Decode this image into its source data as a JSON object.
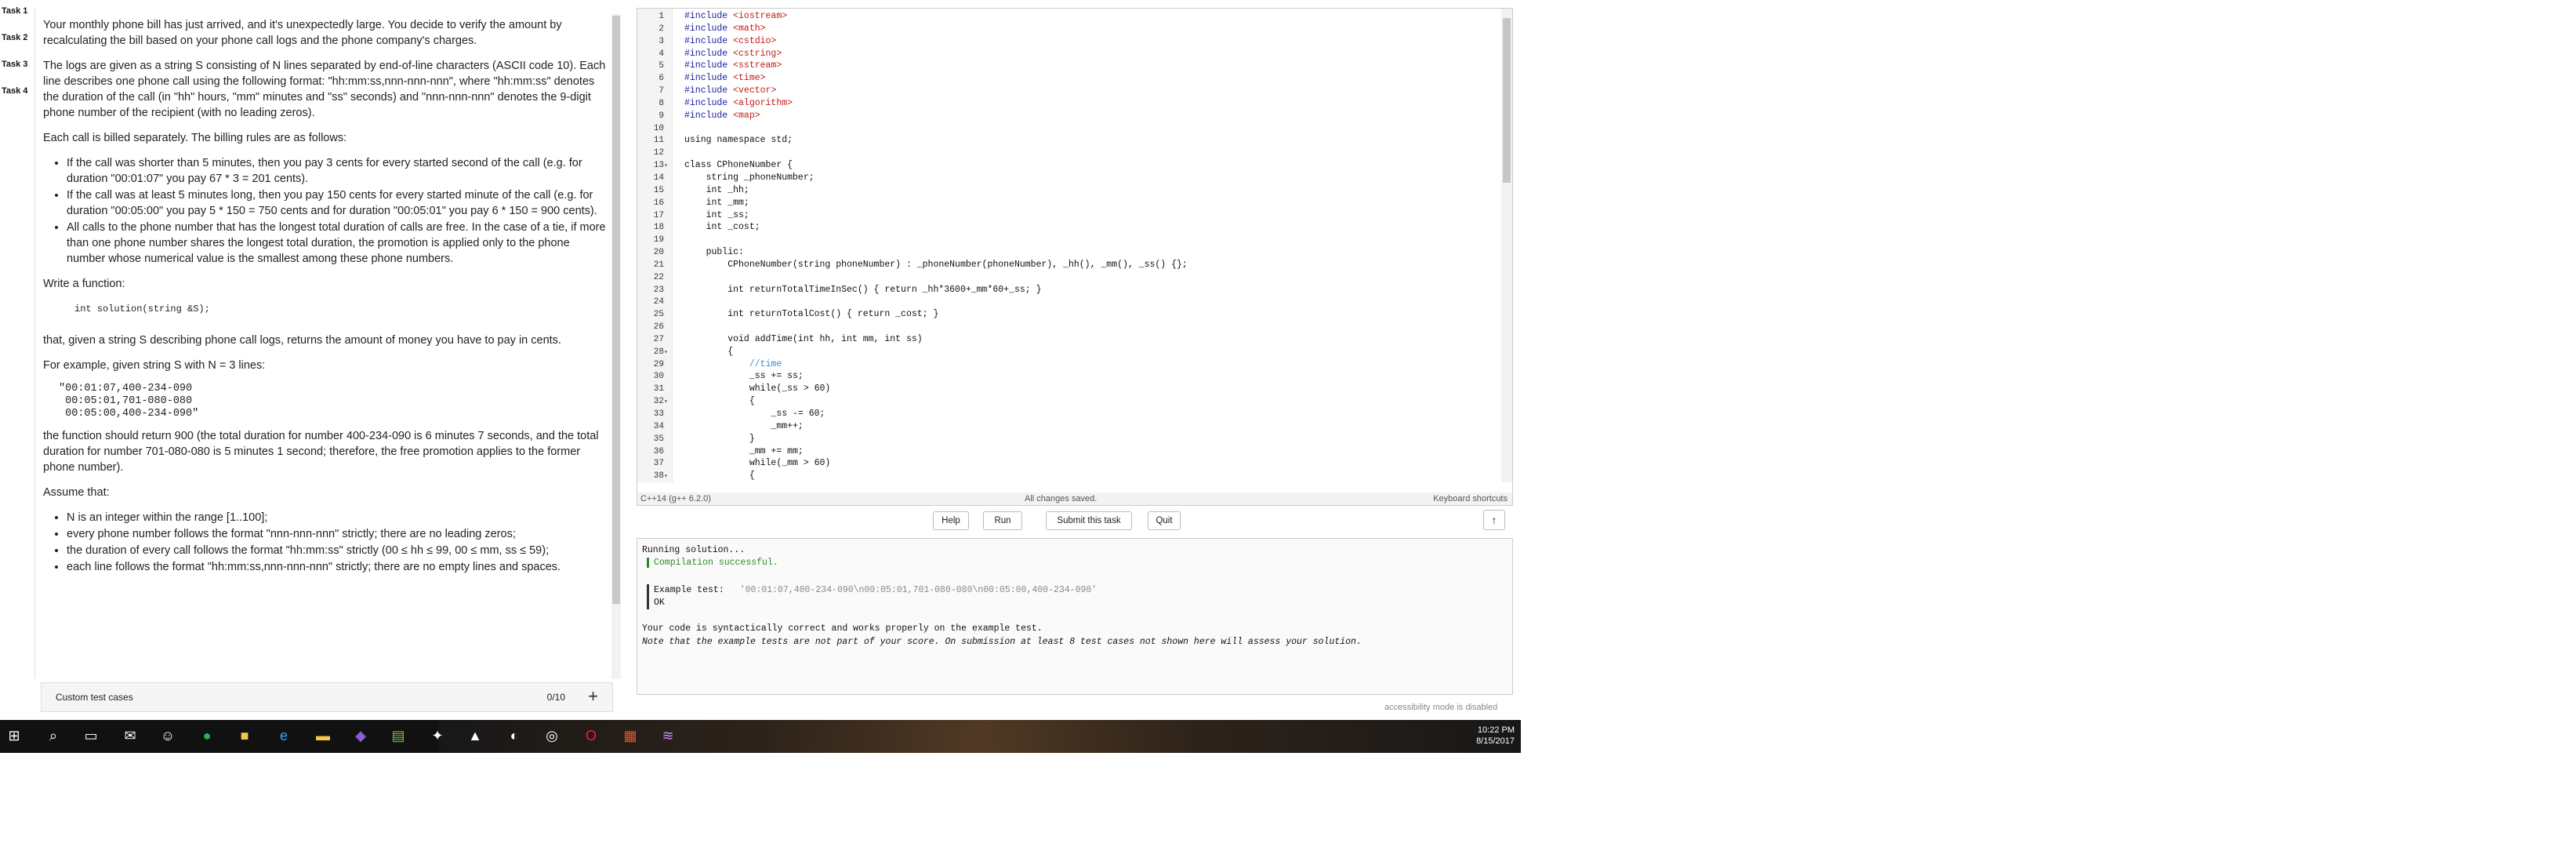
{
  "tabs": [
    "Task 1",
    "Task 2",
    "Task 3",
    "Task 4"
  ],
  "description": {
    "p1": "Your monthly phone bill has just arrived, and it's unexpectedly large. You decide to verify the amount by recalculating the bill based on your phone call logs and the phone company's charges.",
    "p2": "The logs are given as a string S consisting of N lines separated by end-of-line characters (ASCII code 10). Each line describes one phone call using the following format: \"hh:mm:ss,nnn-nnn-nnn\", where \"hh:mm:ss\" denotes the duration of the call (in \"hh\" hours, \"mm\" minutes and \"ss\" seconds) and \"nnn-nnn-nnn\" denotes the 9-digit phone number of the recipient (with no leading zeros).",
    "p3": "Each call is billed separately. The billing rules are as follows:",
    "rules": [
      "If the call was shorter than 5 minutes, then you pay 3 cents for every started second of the call (e.g. for duration \"00:01:07\" you pay 67 * 3 = 201 cents).",
      "If the call was at least 5 minutes long, then you pay 150 cents for every started minute of the call (e.g. for duration \"00:05:00\" you pay 5 * 150 = 750 cents and for duration \"00:05:01\" you pay 6 * 150 = 900 cents).",
      "All calls to the phone number that has the longest total duration of calls are free. In the case of a tie, if more than one phone number shares the longest total duration, the promotion is applied only to the phone number whose numerical value is the smallest among these phone numbers."
    ],
    "p4": "Write a function:",
    "signature": "int solution(string &S);",
    "p5": "that, given a string S describing phone call logs, returns the amount of money you have to pay in cents.",
    "p6": "For example, given string S with N = 3 lines:",
    "sample": "\"00:01:07,400-234-090\n 00:05:01,701-080-080\n 00:05:00,400-234-090\"",
    "p7": "the function should return 900 (the total duration for number 400-234-090 is 6 minutes 7 seconds, and the total duration for number 701-080-080 is 5 minutes 1 second; therefore, the free promotion applies to the former phone number).",
    "p8": "Assume that:",
    "assume": [
      "N is an integer within the range [1..100];",
      "every phone number follows the format \"nnn-nnn-nnn\" strictly; there are no leading zeros;",
      "the duration of every call follows the format \"hh:mm:ss\" strictly (00 ≤ hh ≤ 99, 00 ≤ mm, ss ≤ 59);",
      "each line follows the format \"hh:mm:ss,nnn-nnn-nnn\" strictly; there are no empty lines and spaces."
    ]
  },
  "custom_tests": {
    "label": "Custom test cases",
    "count": "0/10",
    "add": "+"
  },
  "editor": {
    "lines": [
      {
        "n": "1",
        "t": "#include <iostream>"
      },
      {
        "n": "2",
        "t": "#include <math>"
      },
      {
        "n": "3",
        "t": "#include <cstdio>"
      },
      {
        "n": "4",
        "t": "#include <cstring>"
      },
      {
        "n": "5",
        "t": "#include <sstream>"
      },
      {
        "n": "6",
        "t": "#include <time>"
      },
      {
        "n": "7",
        "t": "#include <vector>"
      },
      {
        "n": "8",
        "t": "#include <algorithm>"
      },
      {
        "n": "9",
        "t": "#include <map>"
      },
      {
        "n": "10",
        "t": ""
      },
      {
        "n": "11",
        "t": "using namespace std;"
      },
      {
        "n": "12",
        "t": ""
      },
      {
        "n": "13",
        "t": "class CPhoneNumber {",
        "fold": true
      },
      {
        "n": "14",
        "t": "    string _phoneNumber;"
      },
      {
        "n": "15",
        "t": "    int _hh;"
      },
      {
        "n": "16",
        "t": "    int _mm;"
      },
      {
        "n": "17",
        "t": "    int _ss;"
      },
      {
        "n": "18",
        "t": "    int _cost;"
      },
      {
        "n": "19",
        "t": ""
      },
      {
        "n": "20",
        "t": "    public:"
      },
      {
        "n": "21",
        "t": "        CPhoneNumber(string phoneNumber) : _phoneNumber(phoneNumber), _hh(), _mm(), _ss() {};"
      },
      {
        "n": "22",
        "t": ""
      },
      {
        "n": "23",
        "t": "        int returnTotalTimeInSec() { return _hh*3600+_mm*60+_ss; }"
      },
      {
        "n": "24",
        "t": ""
      },
      {
        "n": "25",
        "t": "        int returnTotalCost() { return _cost; }"
      },
      {
        "n": "26",
        "t": ""
      },
      {
        "n": "27",
        "t": "        void addTime(int hh, int mm, int ss)"
      },
      {
        "n": "28",
        "t": "        {",
        "fold": true
      },
      {
        "n": "29",
        "t": "            //time"
      },
      {
        "n": "30",
        "t": "            _ss += ss;"
      },
      {
        "n": "31",
        "t": "            while(_ss > 60)"
      },
      {
        "n": "32",
        "t": "            {",
        "fold": true
      },
      {
        "n": "33",
        "t": "                _ss -= 60;"
      },
      {
        "n": "34",
        "t": "                _mm++;"
      },
      {
        "n": "35",
        "t": "            }"
      },
      {
        "n": "36",
        "t": "            _mm += mm;"
      },
      {
        "n": "37",
        "t": "            while(_mm > 60)"
      },
      {
        "n": "38",
        "t": "            {",
        "fold": true
      }
    ],
    "status_left": "C++14 (g++ 6.2.0)",
    "status_center": "All changes saved.",
    "status_right": "Keyboard shortcuts"
  },
  "buttons": {
    "help": "Help",
    "run": "Run",
    "submit": "Submit this task",
    "quit": "Quit",
    "up": "↑"
  },
  "output": {
    "running": "Running solution...",
    "compiled": "Compilation successful.",
    "example_label": "Example test:",
    "example_value": "'00:01:07,400-234-090\\n00:05:01,701-080-080\\n00:05:00,400-234-090'",
    "ok": "OK",
    "correct": "Your code is syntactically correct and works properly on the example test.",
    "note": "Note that the example tests are not part of your score. On submission at least 8 test cases not shown here will assess your solution."
  },
  "accessibility": "accessibility mode is disabled",
  "taskbar": {
    "time": "10:22 PM",
    "date": "8/15/2017",
    "icons": [
      "windows-icon",
      "search-icon",
      "task-view-icon",
      "mail-icon",
      "cat-icon",
      "spotify-icon",
      "sticky-notes-icon",
      "edge-icon",
      "file-explorer-icon",
      "visual-studio-icon",
      "notepad-icon",
      "app-icon",
      "app-icon-2",
      "app-icon-3",
      "app-icon-4",
      "opera-icon",
      "app-icon-5",
      "app-icon-6"
    ]
  }
}
